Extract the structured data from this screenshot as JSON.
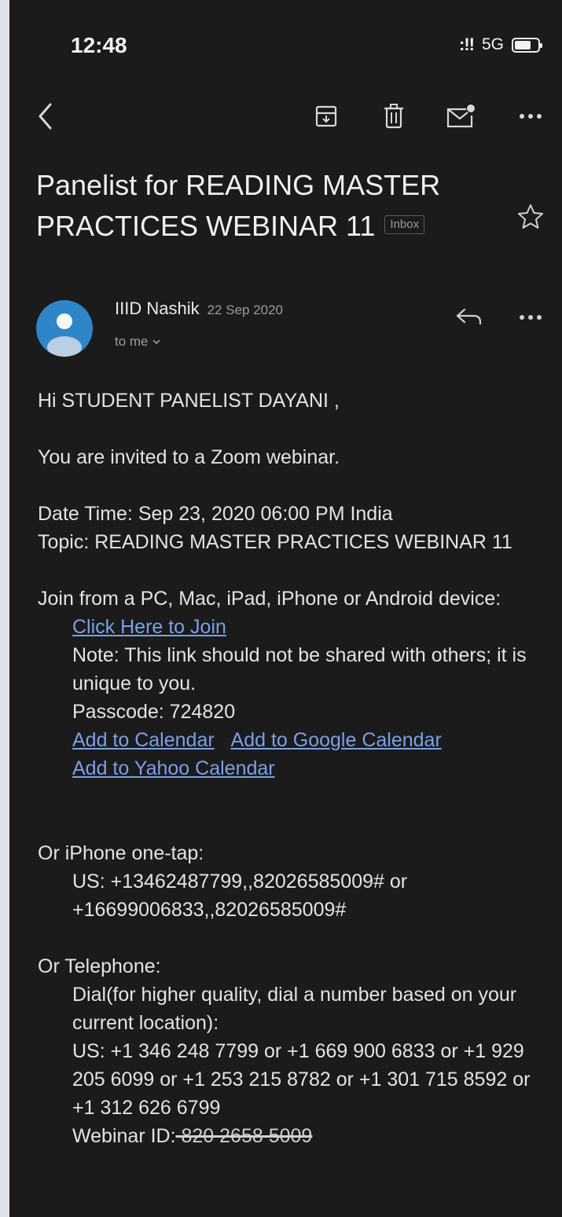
{
  "status_bar": {
    "time": "12:48",
    "signal": ":!!",
    "network": "5G"
  },
  "toolbar": {
    "back_icon": "chevron-left-icon",
    "archive_icon": "archive-icon",
    "delete_icon": "trash-icon",
    "mark_unread_icon": "mail-unread-icon",
    "more_icon": "more-horizontal-icon"
  },
  "email": {
    "subject": "Panelist for READING MASTER PRACTICES WEBINAR 11",
    "label": "Inbox",
    "sender": "IIID Nashik",
    "date": "22 Sep 2020",
    "recipient": "to me",
    "greeting": "Hi STUDENT PANELIST DAYANI ,",
    "intro": "You are invited to a Zoom webinar.",
    "date_time": "Date Time: Sep 23, 2020 06:00 PM India",
    "topic": "Topic: READING MASTER PRACTICES WEBINAR 11",
    "join_text": "Join from a PC, Mac, iPad, iPhone or Android device:",
    "join_link": "Click Here to Join",
    "note": "Note: This link should not be shared with others; it is unique to you.",
    "passcode": "Passcode: 724820",
    "calendar_link": "Add to Calendar",
    "google_calendar_link": "Add to Google Calendar",
    "yahoo_calendar_link": "Add to Yahoo Calendar",
    "iphone_heading": "Or iPhone one-tap:",
    "iphone_numbers": "US: +13462487799,,82026585009# or +16699006833,,82026585009#",
    "telephone_heading": "Or Telephone:",
    "dial_text": "Dial(for higher quality, dial a number based on your current location):",
    "us_numbers": "US: +1 346 248 7799 or +1 669 900 6833 or +1 929 205 6099 or +1 253 215 8782 or +1 301 715 8592 or +1 312 626 6799",
    "webinar_id_label": "Webinar ID:",
    "webinar_id_value": " 820 2658 5009"
  },
  "colors": {
    "background": "#1b1b1b",
    "link": "#7aa0e6",
    "avatar": "#2e86c8"
  }
}
